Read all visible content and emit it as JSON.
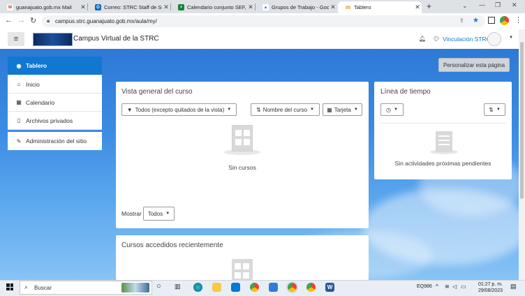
{
  "browser": {
    "tabs": [
      {
        "title": "guanajuato.gob.mx Mail",
        "icon": "gmail-icon",
        "color": "#d93025",
        "glyph": "M"
      },
      {
        "title": "Correo: STRC Staff de Secretar",
        "icon": "outlook-icon",
        "color": "#0f6cbd",
        "glyph": "O"
      },
      {
        "title": "Calendario conjunto SEF, SEA",
        "icon": "sheets-icon",
        "color": "#188038",
        "glyph": "+"
      },
      {
        "title": "Grupos de Trabajo - Google",
        "icon": "drive-icon",
        "color": "#fbbc04",
        "glyph": "▲"
      },
      {
        "title": "Tablero",
        "icon": "moodle-icon",
        "color": "#f98012",
        "glyph": "m"
      }
    ],
    "url": "campus.strc.guanajuato.gob.mx/aula/my/"
  },
  "site": {
    "title": "Campus Virtual de la STRC",
    "user": "Vinculación STRC"
  },
  "sidebar": {
    "items": [
      {
        "label": "Tablero",
        "icon": "dashboard-icon",
        "glyph": "◉"
      },
      {
        "label": "Inicio",
        "icon": "home-icon",
        "glyph": "⌂"
      },
      {
        "label": "Calendario",
        "icon": "calendar-icon",
        "glyph": "▦"
      },
      {
        "label": "Archivos privados",
        "icon": "file-icon",
        "glyph": "▯"
      },
      {
        "label": "Administración del sitio",
        "icon": "wrench-icon",
        "glyph": "✎"
      }
    ]
  },
  "page": {
    "customize_label": "Personalizar esta página"
  },
  "overview": {
    "title": "Vista general del curso",
    "filter_label": "Todos (excepto quitados de la vista)",
    "sort_label": "Nombre del curso",
    "view_label": "Tarjeta",
    "empty_text": "Sin cursos",
    "show_label": "Mostrar",
    "show_value": "Todos"
  },
  "timeline": {
    "title": "Línea de tiempo",
    "empty_text": "Sin actividades próximas pendientes"
  },
  "recent": {
    "title": "Cursos accedidos recientemente"
  },
  "taskbar": {
    "search_label": "Buscar",
    "keyboard": "EQ986",
    "time": "01:27 p. m.",
    "date": "29/08/2023"
  },
  "colors": {
    "accent": "#1177d1",
    "sidebar_active": "#1177d1"
  }
}
